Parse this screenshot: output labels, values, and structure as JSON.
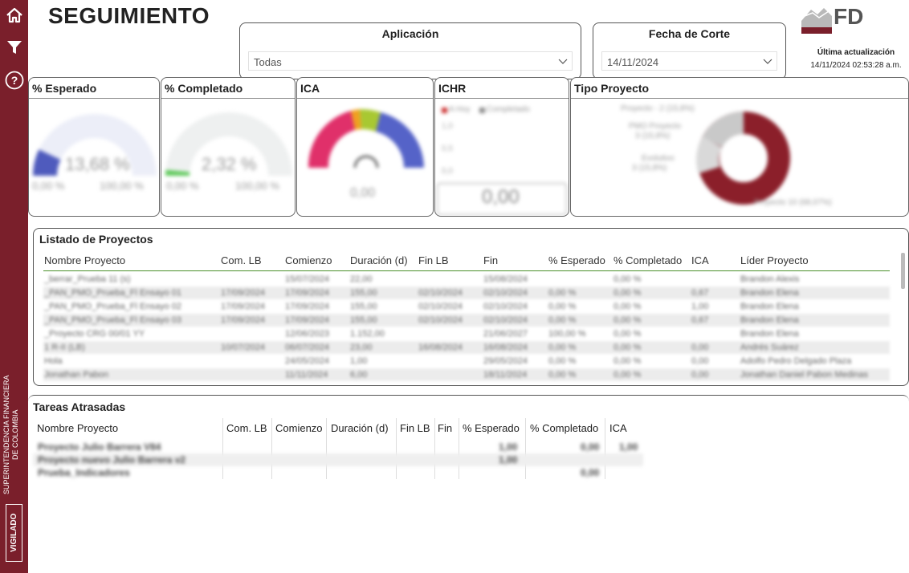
{
  "sidebar": {
    "icons": [
      "home-icon",
      "filter-icon",
      "help-icon"
    ],
    "org_line1": "SUPERINTENDENCIA FINANCIERA",
    "org_line2": "DE COLOMBIA",
    "vigilado": "VIGILADO",
    "color": "#7a1f2b"
  },
  "header": {
    "title": "SEGUIMIENTO",
    "logo_text": "FD",
    "last_update_label": "Última actualización",
    "last_update_value": "14/11/2024 02:53:28 a.m."
  },
  "filters": {
    "aplicacion": {
      "label": "Aplicación",
      "value": "Todas"
    },
    "fecha_corte": {
      "label": "Fecha de Corte",
      "value": "14/11/2024"
    }
  },
  "cards": {
    "esperado": {
      "title": "% Esperado",
      "value": "13,68 %",
      "min": "0,00 %",
      "max": "100,00 %",
      "level": 0.14,
      "color": "#4f5bbd"
    },
    "completado": {
      "title": "% Completado",
      "value": "2,32 %",
      "min": "0,00 %",
      "max": "100,00 %",
      "level": 0.03,
      "color": "#5ec95a"
    },
    "ica": {
      "title": "ICA",
      "value": "0,00"
    },
    "ichr": {
      "title": "ICHR",
      "legend_1": "A Hoy",
      "legend_2": "Completado",
      "ticks": [
        "1,0",
        "0,5",
        "0,0"
      ],
      "value": "0,00"
    },
    "tipo": {
      "title": "Tipo Proyecto",
      "labels": [
        "Proyecto - 2 (15,8%)",
        "PMO Proyecto",
        "3 (15,8%)",
        "Evolutivo",
        "3 (15,8%)",
        "Proyecto 10 (68,07%)"
      ],
      "color": "#8b1f2a"
    }
  },
  "projects": {
    "title": "Listado de Proyectos",
    "columns": [
      "Nombre Proyecto",
      "Com. LB",
      "Comienzo",
      "Duración (d)",
      "Fin LB",
      "Fin",
      "% Esperado",
      "% Completado",
      "ICA",
      "Líder Proyecto"
    ],
    "rows": [
      [
        "_berrar_Prueba 11 (s)",
        "",
        "15/07/2024",
        "22,00",
        "",
        "15/08/2024",
        "",
        "0,00 %",
        "",
        "Brandon Alexis"
      ],
      [
        "_PAN_PMO_Prueba_Fl Ensayo 01",
        "17/09/2024",
        "17/09/2024",
        "155,00",
        "02/10/2024",
        "02/10/2024",
        "0,00 %",
        "0,00 %",
        "0,67",
        "Brandon Elena"
      ],
      [
        "_PAN_PMO_Prueba_Fl Ensayo 02",
        "17/09/2024",
        "17/09/2024",
        "155,00",
        "02/10/2024",
        "02/10/2024",
        "0,00 %",
        "0,00 %",
        "1,00",
        "Brandon Elena"
      ],
      [
        "_PAN_PMO_Prueba_Fl Ensayo 03",
        "17/09/2024",
        "17/09/2024",
        "155,00",
        "02/10/2024",
        "02/10/2024",
        "0,00 %",
        "0,00 %",
        "0,67",
        "Brandon Elena"
      ],
      [
        "_Proyecto CRG 00/01 YY",
        "",
        "12/06/2023",
        "1.152,00",
        "",
        "21/06/2027",
        "100,00 %",
        "0,00 %",
        "",
        "Brandon Elena"
      ],
      [
        "1 R-II (LB)",
        "10/07/2024",
        "06/07/2024",
        "23,00",
        "16/08/2024",
        "16/08/2024",
        "0,00 %",
        "0,00 %",
        "0,00",
        "Andrés Suárez"
      ],
      [
        "Hola",
        "",
        "24/05/2024",
        "1,00",
        "",
        "29/05/2024",
        "0,00 %",
        "0,00 %",
        "0,00",
        "Adolfo Pedro Delgado Plaza"
      ],
      [
        "Jonathan Pabon",
        "",
        "11/11/2024",
        "6,00",
        "",
        "18/11/2024",
        "0,00 %",
        "0,00 %",
        "0,00",
        "Jonathan Daniel Pabon Medinas"
      ]
    ]
  },
  "tareas": {
    "title": "Tareas Atrasadas",
    "columns": [
      "Nombre Proyecto",
      "Com. LB",
      "Comienzo",
      "Duración (d)",
      "Fin LB",
      "Fin",
      "% Esperado",
      "% Completado",
      "ICA"
    ],
    "rows": [
      [
        "Proyecto Julio Barrera V84",
        "1,00",
        "0,00",
        "1,00"
      ],
      [
        "Proyecto nuevo Julio Barrera v2",
        "1,00",
        "",
        ""
      ],
      [
        "Prueba_Indicadores",
        "",
        "0,00",
        ""
      ]
    ]
  }
}
